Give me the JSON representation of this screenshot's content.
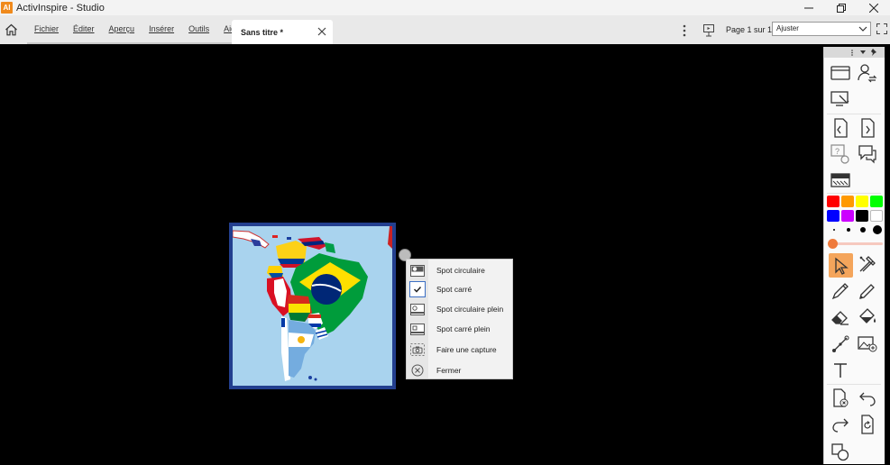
{
  "window": {
    "app_logo_text": "AI",
    "title": "ActivInspire - Studio"
  },
  "menu": {
    "items": [
      "Fichier",
      "Éditer",
      "Aperçu",
      "Insérer",
      "Outils",
      "Aide"
    ]
  },
  "tab": {
    "label": "Sans titre *"
  },
  "page_indicator": "Page 1 sur 1",
  "zoom": {
    "selected": "Ajuster"
  },
  "context_menu": {
    "items": [
      {
        "label": "Spot circulaire",
        "icon": "spot-circle-icon",
        "checked": false
      },
      {
        "label": "Spot carré",
        "icon": "check-icon",
        "checked": true
      },
      {
        "label": "Spot circulaire plein",
        "icon": "spot-circle-full-icon",
        "checked": false
      },
      {
        "label": "Spot carré plein",
        "icon": "spot-square-full-icon",
        "checked": false
      },
      {
        "label": "Faire une capture",
        "icon": "camera-icon",
        "checked": false
      },
      {
        "label": "Fermer",
        "icon": "close-circle-icon",
        "checked": false
      }
    ]
  },
  "palette": {
    "colors": [
      "#ff0000",
      "#ff9900",
      "#ffff00",
      "#00ff00",
      "#0000ff",
      "#cc00ff",
      "#000000",
      "#ffffff"
    ],
    "active_color": "#ef7a3c"
  },
  "accent": "#f4a55b"
}
